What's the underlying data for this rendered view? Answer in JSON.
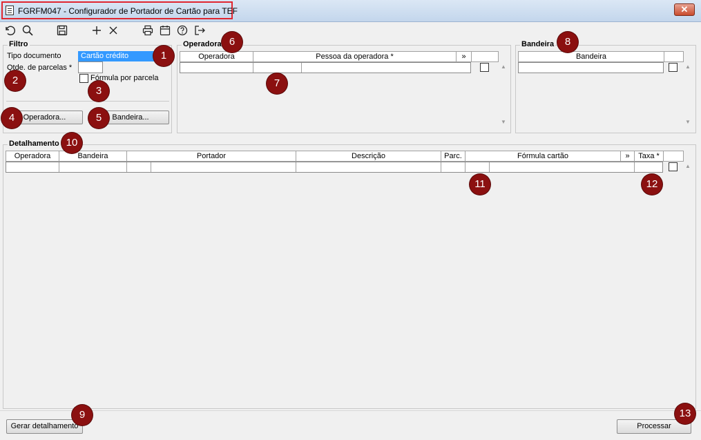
{
  "window": {
    "title": "FGRFM047 - Configurador de Portador de Cartão para TEF",
    "close_label": "✕"
  },
  "toolbar": {
    "icons": [
      "undo-icon",
      "search-icon",
      "save-icon",
      "add-icon",
      "delete-icon",
      "print-icon",
      "calendar-icon",
      "help-icon",
      "exit-icon"
    ]
  },
  "filtro": {
    "title": "Filtro",
    "tipo_documento_label": "Tipo documento",
    "tipo_documento_value": "Cartão crédito",
    "parcelas_label": "Qtde. de parcelas *",
    "parcelas_value": "",
    "formula_label": "Fórmula por parcela",
    "operadora_button": "Operadora...",
    "bandeira_button": "Bandeira..."
  },
  "operadora": {
    "title": "Operadora",
    "columns": [
      "Operadora",
      "Pessoa da operadora *",
      "»",
      ""
    ]
  },
  "bandeira": {
    "title": "Bandeira",
    "columns": [
      "Bandeira",
      ""
    ]
  },
  "detalhamento": {
    "title": "Detalhamento",
    "columns": [
      "Operadora",
      "Bandeira",
      "Portador",
      "Descrição",
      "Parc.",
      "Fórmula cartão",
      "»",
      "Taxa *",
      ""
    ]
  },
  "footer": {
    "gerar_button": "Gerar detalhamento",
    "processar_button": "Processar"
  },
  "callouts": [
    "1",
    "2",
    "3",
    "4",
    "5",
    "6",
    "7",
    "8",
    "9",
    "10",
    "11",
    "12",
    "13"
  ]
}
